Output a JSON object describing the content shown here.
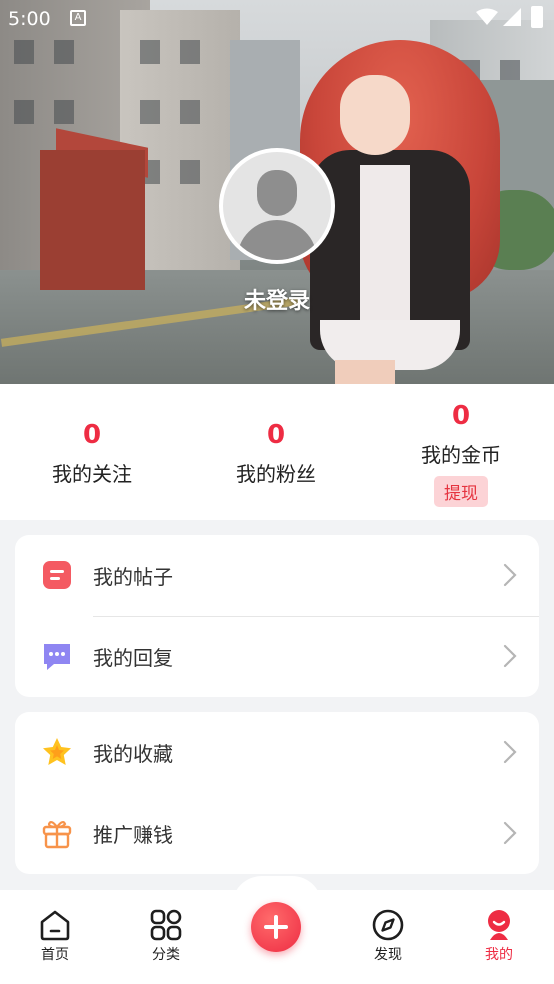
{
  "status_bar": {
    "time": "5:00"
  },
  "profile": {
    "display_name": "未登录"
  },
  "stats": [
    {
      "value": "0",
      "label": "我的关注"
    },
    {
      "value": "0",
      "label": "我的粉丝"
    },
    {
      "value": "0",
      "label": "我的金币",
      "action": "提现"
    }
  ],
  "menu_group_1": [
    {
      "label": "我的帖子",
      "icon": "post-icon"
    },
    {
      "label": "我的回复",
      "icon": "reply-icon"
    }
  ],
  "menu_group_2": [
    {
      "label": "我的收藏",
      "icon": "star-icon"
    },
    {
      "label": "推广赚钱",
      "icon": "gift-icon"
    }
  ],
  "tabbar": {
    "items": [
      {
        "label": "首页",
        "icon": "home-icon"
      },
      {
        "label": "分类",
        "icon": "grid-icon"
      },
      {
        "label": "发现",
        "icon": "compass-icon"
      },
      {
        "label": "我的",
        "icon": "profile-icon",
        "active": true
      }
    ],
    "center_action": "plus-icon"
  },
  "colors": {
    "accent": "#ee2c43",
    "withdraw_bg": "#fcd3d6",
    "page_bg": "#f2f3f5"
  }
}
